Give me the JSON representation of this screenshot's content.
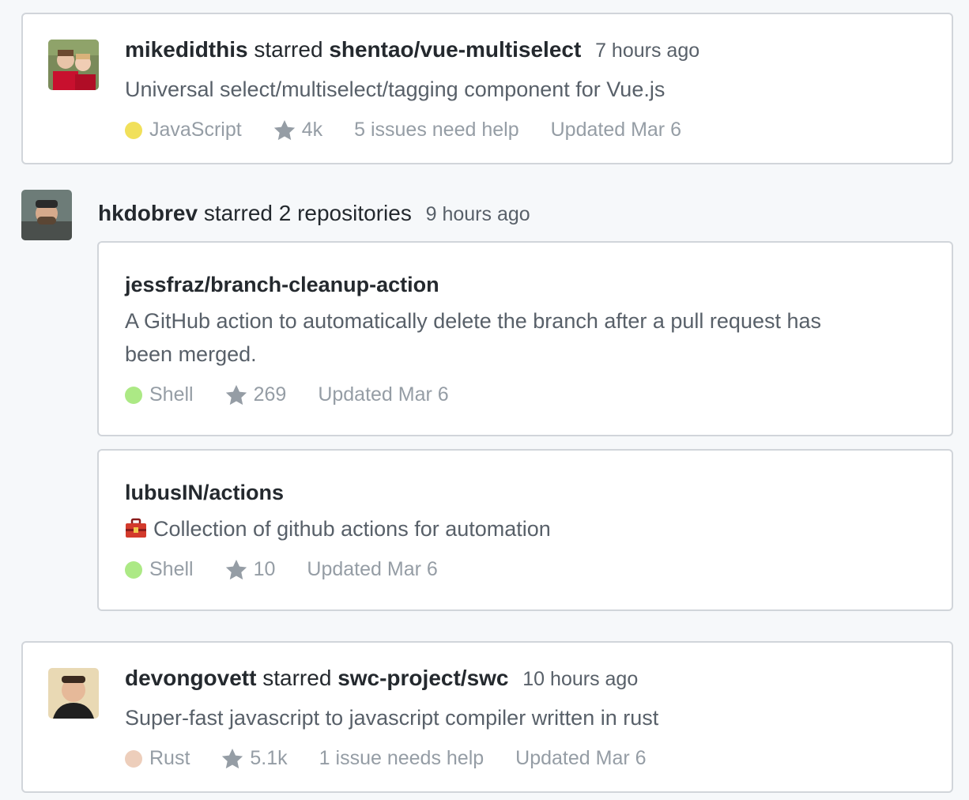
{
  "feed": {
    "event1": {
      "user": "mikedidthis",
      "verb": "starred",
      "repo": "shentao/vue-multiselect",
      "time": "7 hours ago",
      "description": "Universal select/multiselect/tagging component for Vue.js",
      "language": "JavaScript",
      "language_color": "#f1e05a",
      "stars": "4k",
      "issues": "5 issues need help",
      "updated": "Updated Mar 6"
    },
    "event2": {
      "user": "hkdobrev",
      "verb": "starred 2 repositories",
      "time": "9 hours ago",
      "repos": [
        {
          "name": "jessfraz/branch-cleanup-action",
          "description_line1": "A GitHub action to automatically delete the branch after a pull request has",
          "description_line2": "been merged.",
          "language": "Shell",
          "language_color": "#89e051",
          "stars": "269",
          "updated": "Updated Mar 6"
        },
        {
          "name": "lubusIN/actions",
          "icon": "toolbox-icon",
          "description": "Collection of github actions for automation",
          "language": "Shell",
          "language_color": "#89e051",
          "stars": "10",
          "updated": "Updated Mar 6"
        }
      ]
    },
    "event3": {
      "user": "devongovett",
      "verb": "starred",
      "repo": "swc-project/swc",
      "time": "10 hours ago",
      "description": "Super-fast javascript to javascript compiler written in rust",
      "language": "Rust",
      "language_color": "#dea584",
      "stars": "5.1k",
      "issues": "1 issue needs help",
      "updated": "Updated Mar 6"
    }
  },
  "icons": {
    "star": "star-icon",
    "toolbox": "toolbox-icon",
    "language": "language-color-dot"
  }
}
